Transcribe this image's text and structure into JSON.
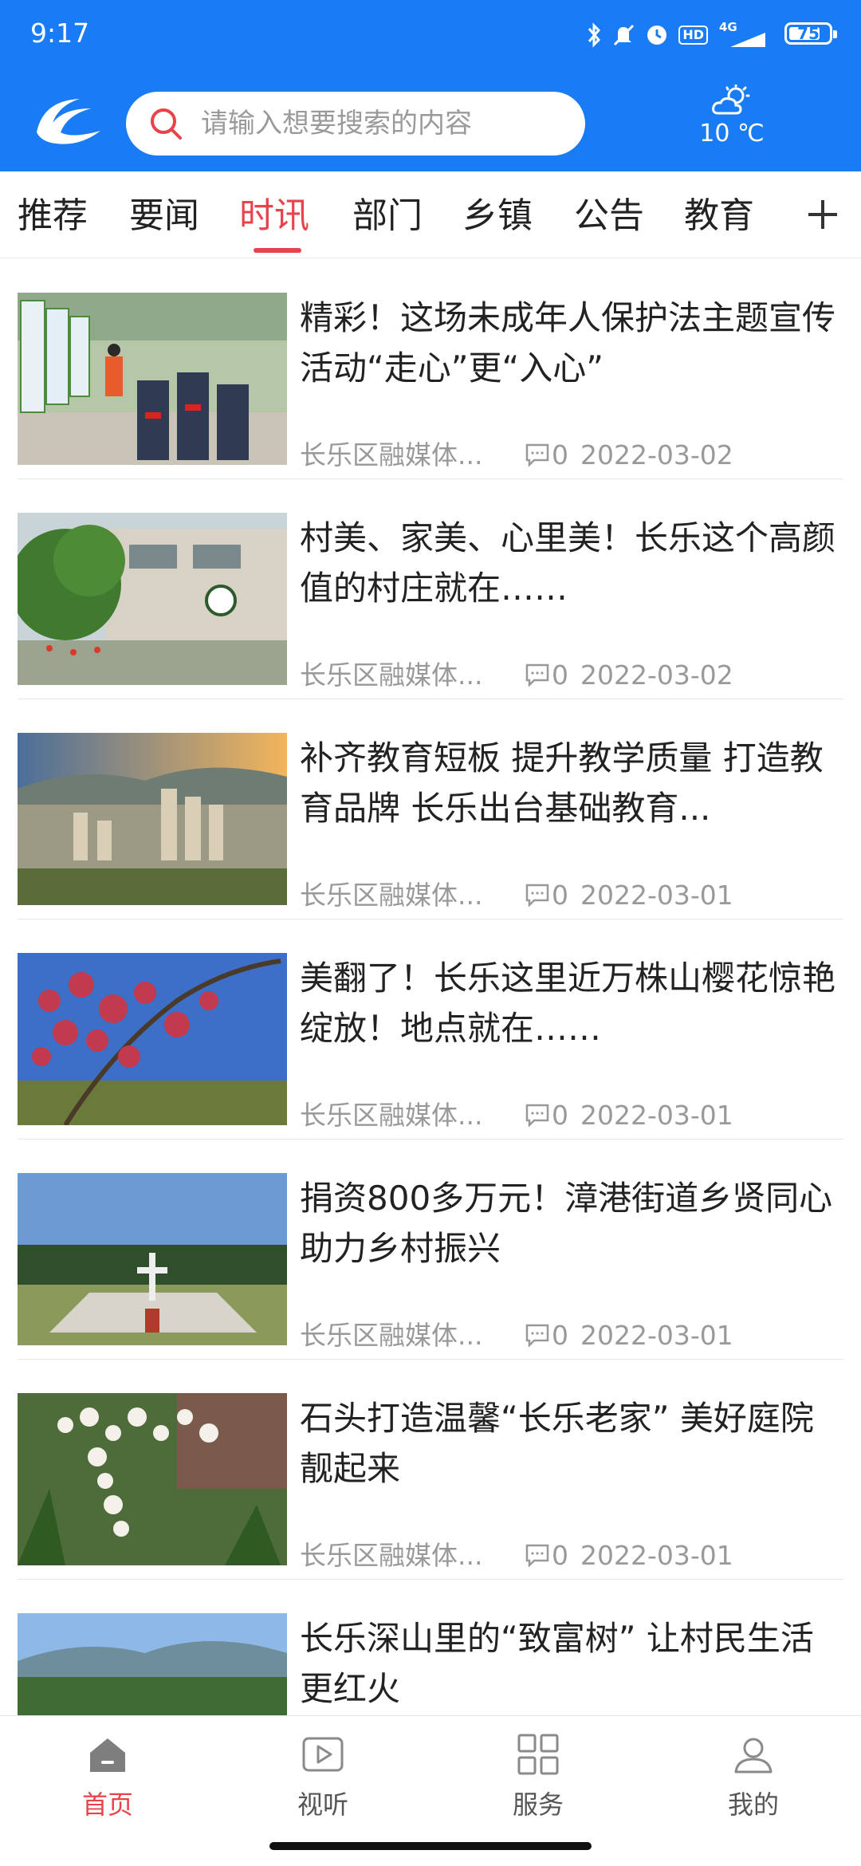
{
  "status_bar": {
    "time": "9:17",
    "network": "4G",
    "hd_label": "HD",
    "battery": "75"
  },
  "header": {
    "search_placeholder": "请输入想要搜索的内容",
    "weather_temp": "10 ℃"
  },
  "tabs": [
    {
      "label": "推荐",
      "active": false
    },
    {
      "label": "要闻",
      "active": false
    },
    {
      "label": "时讯",
      "active": true
    },
    {
      "label": "部门",
      "active": false
    },
    {
      "label": "乡镇",
      "active": false
    },
    {
      "label": "公告",
      "active": false
    },
    {
      "label": "教育",
      "active": false
    }
  ],
  "articles": [
    {
      "title": "精彩！这场未成年人保护法主题宣传活动“走心”更“入心”",
      "source": "长乐区融媒体...",
      "comments": "0",
      "date": "2022-03-02"
    },
    {
      "title": "村美、家美、心里美！长乐这个高颜值的村庄就在……",
      "source": "长乐区融媒体...",
      "comments": "0",
      "date": "2022-03-02"
    },
    {
      "title": "补齐教育短板 提升教学质量 打造教育品牌 长乐出台基础教育...",
      "source": "长乐区融媒体...",
      "comments": "0",
      "date": "2022-03-01"
    },
    {
      "title": "美翻了！长乐这里近万株山樱花惊艳绽放！地点就在……",
      "source": "长乐区融媒体...",
      "comments": "0",
      "date": "2022-03-01"
    },
    {
      "title": "捐资800多万元！漳港街道乡贤同心助力乡村振兴",
      "source": "长乐区融媒体...",
      "comments": "0",
      "date": "2022-03-01"
    },
    {
      "title": "石头打造温馨“长乐老家” 美好庭院靓起来",
      "source": "长乐区融媒体...",
      "comments": "0",
      "date": "2022-03-01"
    },
    {
      "title": "长乐深山里的“致富树” 让村民生活更红火",
      "source": "",
      "comments": "",
      "date": ""
    }
  ],
  "bottom_nav": [
    {
      "label": "首页",
      "icon": "home-icon",
      "active": true
    },
    {
      "label": "视听",
      "icon": "play-icon",
      "active": false
    },
    {
      "label": "服务",
      "icon": "grid-icon",
      "active": false
    },
    {
      "label": "我的",
      "icon": "user-icon",
      "active": false
    }
  ],
  "colors": {
    "brand_blue": "#1a7cf5",
    "accent_red": "#e8434a"
  }
}
